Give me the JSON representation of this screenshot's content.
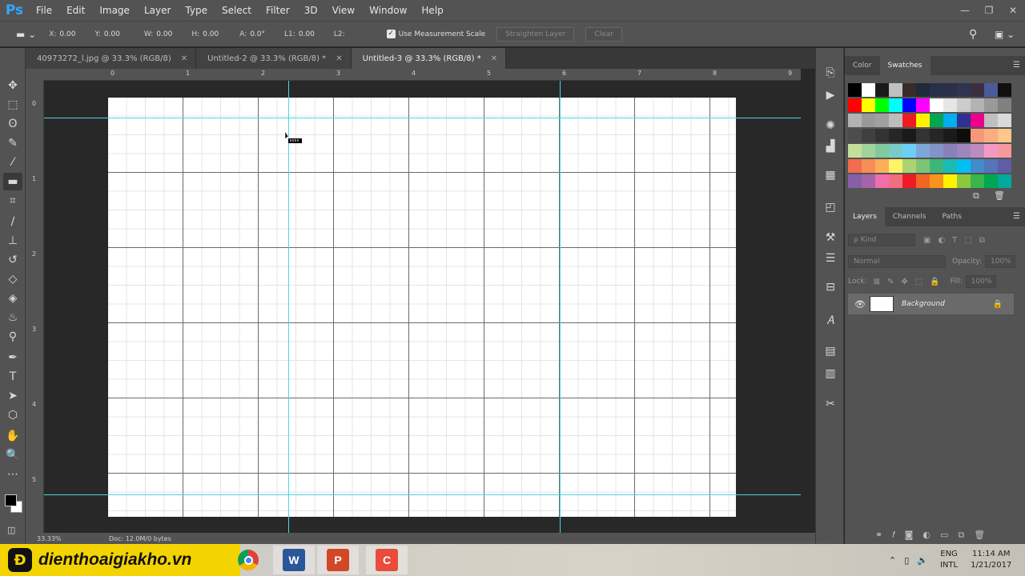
{
  "app": {
    "logo": "Ps"
  },
  "menu": [
    "File",
    "Edit",
    "Image",
    "Layer",
    "Type",
    "Select",
    "Filter",
    "3D",
    "View",
    "Window",
    "Help"
  ],
  "window_controls": {
    "minimize": "—",
    "restore": "❐",
    "close": "✕"
  },
  "options_bar": {
    "x": "0.00",
    "y": "0.00",
    "w": "0.00",
    "h": "0.00",
    "a": "0.0°",
    "l1": "0.00",
    "l2": "",
    "labels": {
      "x": "X:",
      "y": "Y:",
      "w": "W:",
      "h": "H:",
      "a": "A:",
      "l1": "L1:",
      "l2": "L2:"
    },
    "use_measurement_scale_label": "Use Measurement Scale",
    "use_measurement_scale_checked": true,
    "straighten_label": "Straighten Layer",
    "clear_label": "Clear"
  },
  "tabs": [
    {
      "label": "40973272_l.jpg @ 33.3% (RGB/8)",
      "active": false
    },
    {
      "label": "Untitled-2 @ 33.3% (RGB/8) *",
      "active": false
    },
    {
      "label": "Untitled-3 @ 33.3% (RGB/8) *",
      "active": true
    }
  ],
  "ruler_top_numbers": [
    "0",
    "1",
    "2",
    "3",
    "4",
    "5",
    "6",
    "7",
    "8",
    "9"
  ],
  "ruler_left_numbers": [
    "0",
    "1",
    "2",
    "3",
    "4",
    "5"
  ],
  "tools": [
    "move-tool",
    "marquee-tool",
    "lasso-tool",
    "quick-selection-tool",
    "eyedropper-tool",
    "ruler-tool",
    "crop-tool",
    "brush-tool",
    "clone-stamp-tool",
    "history-brush-tool",
    "eraser-tool",
    "paint-bucket-tool",
    "blur-tool",
    "dodge-tool",
    "pen-tool",
    "type-tool",
    "path-selection-tool",
    "shape-tool",
    "hand-tool",
    "zoom-tool",
    "more-tools"
  ],
  "tool_glyphs": [
    "✥",
    "⬚",
    "ʘ",
    "✎",
    "⁄",
    "▬",
    "⌗",
    "∕",
    "⊥",
    "↺",
    "◇",
    "◈",
    "♨",
    "⚲",
    "✒",
    "T",
    "➤",
    "⬡",
    "✋",
    "🔍",
    "⋯"
  ],
  "status_bar": {
    "zoom": "33.33%",
    "doc": "Doc: 12.0M/0 bytes"
  },
  "color_panel": {
    "tabs": [
      "Color",
      "Swatches"
    ],
    "active": "Swatches"
  },
  "swatch_rows": [
    [
      "#000000",
      "#ffffff",
      "#1a1a1a",
      "#c0c0c0",
      "#3a2a2a",
      "#1f2a3a",
      "#26304a",
      "#2a2f4a",
      "#30344f",
      "#3a2f3f",
      "#4a5a9a",
      "#101010",
      "#ffffff",
      "#b0d040",
      "#e0e0e0"
    ],
    [
      "#ff0000",
      "#ffff00",
      "#00ff00",
      "#00ffff",
      "#0000ff",
      "#ff00ff",
      "#ffffff",
      "#e6e6e6",
      "#cccccc",
      "#b3b3b3",
      "#999999",
      "#808080"
    ],
    [
      "#b3b3b3",
      "#999999",
      "#a0a0a0",
      "#bdbdbd",
      "#ed1c24",
      "#fff200",
      "#00a651",
      "#00aeef",
      "#2e3192",
      "#ec008c",
      "#c0c0c0",
      "#d9d9d9"
    ],
    [
      "#4d4d4d",
      "#404040",
      "#333333",
      "#262626",
      "#1a1a1a",
      "#333333",
      "#262626",
      "#1a1a1a",
      "#0d0d0d",
      "#f7977a",
      "#f9ad81",
      "#fdc68a"
    ],
    [
      "#c4df9b",
      "#a3d39c",
      "#82ca9d",
      "#7accc8",
      "#6dcff6",
      "#7da7d9",
      "#8393ca",
      "#8781bd",
      "#a186be",
      "#bd8cbf",
      "#f49ac2",
      "#f6989d"
    ],
    [
      "#f26c4f",
      "#f68e55",
      "#fbaf5c",
      "#fff467",
      "#acd372",
      "#7cc576",
      "#3bb878",
      "#1abbb4",
      "#00bff3",
      "#438ccb",
      "#5574b9",
      "#605ca8"
    ],
    [
      "#855fa8",
      "#a763a8",
      "#f06eaa",
      "#f26d7d",
      "#ed1c24",
      "#f26522",
      "#f7941d",
      "#fff200",
      "#8dc63f",
      "#39b54a",
      "#00a651",
      "#00a99d"
    ]
  ],
  "layers_panel": {
    "tabs": [
      "Layers",
      "Channels",
      "Paths"
    ],
    "active": "Layers",
    "kind_label": "ρ Kind",
    "blend_mode": "Normal",
    "opacity_label": "Opacity:",
    "opacity": "100%",
    "lock_label": "Lock:",
    "fill_label": "Fill:",
    "fill": "100%",
    "layers": [
      {
        "name": "Background",
        "visible": true,
        "locked": true
      }
    ]
  },
  "watermark": {
    "icon": "Đ",
    "text": "dienthoaigiakho.vn"
  },
  "taskbar": {
    "apps": [
      {
        "name": "chrome",
        "label": "",
        "color": "#db4437"
      },
      {
        "name": "word",
        "label": "W",
        "color": "#2b579a"
      },
      {
        "name": "powerpoint",
        "label": "P",
        "color": "#d24726"
      },
      {
        "name": "camtasia",
        "label": "C",
        "color": "#e84c3d"
      }
    ],
    "lang_top": "ENG",
    "lang_bottom": "INTL",
    "time": "11:14 AM",
    "date": "1/21/2017"
  }
}
